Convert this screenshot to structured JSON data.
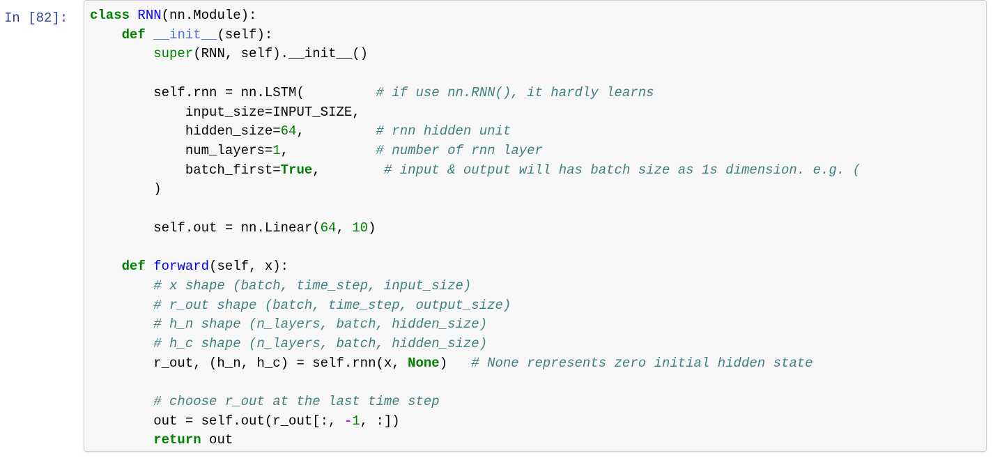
{
  "cell": {
    "prompt": "In [82]:",
    "kernel_language": "python",
    "background_color": "#f7f7f7",
    "border_color": "#cfcfcf",
    "colors": {
      "prompt": "#303f9f",
      "keyword": "#008000",
      "builtin": "#008000",
      "class_name": "#0000ff",
      "function_name": "#0000ff",
      "number": "#008000",
      "operator": "#aa22ff",
      "comment": "#408080",
      "plain": "#000000"
    },
    "lines": [
      {
        "id": "line-1",
        "tokens": [
          {
            "t": "class",
            "c": "keyword"
          },
          {
            "t": " ",
            "c": "plain"
          },
          {
            "t": "RNN",
            "c": "classname"
          },
          {
            "t": "(nn.Module):",
            "c": "plain"
          }
        ]
      },
      {
        "id": "line-2",
        "tokens": [
          {
            "t": "    ",
            "c": "plain"
          },
          {
            "t": "def",
            "c": "keyword"
          },
          {
            "t": " ",
            "c": "plain"
          },
          {
            "t": "__init__",
            "c": "magic"
          },
          {
            "t": "(self):",
            "c": "plain"
          }
        ]
      },
      {
        "id": "line-3",
        "tokens": [
          {
            "t": "        ",
            "c": "plain"
          },
          {
            "t": "super",
            "c": "builtin"
          },
          {
            "t": "(RNN, self).__init__()",
            "c": "plain"
          }
        ]
      },
      {
        "id": "line-4",
        "tokens": [
          {
            "t": "",
            "c": "plain"
          }
        ]
      },
      {
        "id": "line-5",
        "tokens": [
          {
            "t": "        self.rnn = nn.LSTM(         ",
            "c": "plain"
          },
          {
            "t": "# if use nn.RNN(), it hardly learns",
            "c": "comment"
          }
        ]
      },
      {
        "id": "line-6",
        "tokens": [
          {
            "t": "            input_size=INPUT_SIZE,",
            "c": "plain"
          }
        ]
      },
      {
        "id": "line-7",
        "tokens": [
          {
            "t": "            hidden_size=",
            "c": "plain"
          },
          {
            "t": "64",
            "c": "number"
          },
          {
            "t": ",         ",
            "c": "plain"
          },
          {
            "t": "# rnn hidden unit",
            "c": "comment"
          }
        ]
      },
      {
        "id": "line-8",
        "tokens": [
          {
            "t": "            num_layers=",
            "c": "plain"
          },
          {
            "t": "1",
            "c": "number"
          },
          {
            "t": ",           ",
            "c": "plain"
          },
          {
            "t": "# number of rnn layer",
            "c": "comment"
          }
        ]
      },
      {
        "id": "line-9",
        "tokens": [
          {
            "t": "            batch_first=",
            "c": "plain"
          },
          {
            "t": "True",
            "c": "bool"
          },
          {
            "t": ",        ",
            "c": "plain"
          },
          {
            "t": "# input & output will has batch size as 1s dimension. e.g. (",
            "c": "comment"
          }
        ]
      },
      {
        "id": "line-10",
        "tokens": [
          {
            "t": "        )",
            "c": "plain"
          }
        ]
      },
      {
        "id": "line-11",
        "tokens": [
          {
            "t": "",
            "c": "plain"
          }
        ]
      },
      {
        "id": "line-12",
        "tokens": [
          {
            "t": "        self.out = nn.Linear(",
            "c": "plain"
          },
          {
            "t": "64",
            "c": "number"
          },
          {
            "t": ", ",
            "c": "plain"
          },
          {
            "t": "10",
            "c": "number"
          },
          {
            "t": ")",
            "c": "plain"
          }
        ]
      },
      {
        "id": "line-13",
        "tokens": [
          {
            "t": "",
            "c": "plain"
          }
        ]
      },
      {
        "id": "line-14",
        "tokens": [
          {
            "t": "    ",
            "c": "plain"
          },
          {
            "t": "def",
            "c": "keyword"
          },
          {
            "t": " ",
            "c": "plain"
          },
          {
            "t": "forward",
            "c": "funcname"
          },
          {
            "t": "(self, x):",
            "c": "plain"
          }
        ]
      },
      {
        "id": "line-15",
        "tokens": [
          {
            "t": "        ",
            "c": "plain"
          },
          {
            "t": "# x shape (batch, time_step, input_size)",
            "c": "comment"
          }
        ]
      },
      {
        "id": "line-16",
        "tokens": [
          {
            "t": "        ",
            "c": "plain"
          },
          {
            "t": "# r_out shape (batch, time_step, output_size)",
            "c": "comment"
          }
        ]
      },
      {
        "id": "line-17",
        "tokens": [
          {
            "t": "        ",
            "c": "plain"
          },
          {
            "t": "# h_n shape (n_layers, batch, hidden_size)",
            "c": "comment"
          }
        ]
      },
      {
        "id": "line-18",
        "tokens": [
          {
            "t": "        ",
            "c": "plain"
          },
          {
            "t": "# h_c shape (n_layers, batch, hidden_size)",
            "c": "comment"
          }
        ]
      },
      {
        "id": "line-19",
        "tokens": [
          {
            "t": "        r_out, (h_n, h_c) = self.rnn(x, ",
            "c": "plain"
          },
          {
            "t": "None",
            "c": "bool"
          },
          {
            "t": ")   ",
            "c": "plain"
          },
          {
            "t": "# None represents zero initial hidden state",
            "c": "comment"
          }
        ]
      },
      {
        "id": "line-20",
        "tokens": [
          {
            "t": "",
            "c": "plain"
          }
        ]
      },
      {
        "id": "line-21",
        "tokens": [
          {
            "t": "        ",
            "c": "plain"
          },
          {
            "t": "# choose r_out at the last time step",
            "c": "comment"
          }
        ]
      },
      {
        "id": "line-22",
        "tokens": [
          {
            "t": "        out = self.out(r_out[:, ",
            "c": "plain"
          },
          {
            "t": "-",
            "c": "operator"
          },
          {
            "t": "1",
            "c": "number"
          },
          {
            "t": ", :])",
            "c": "plain"
          }
        ]
      },
      {
        "id": "line-23",
        "tokens": [
          {
            "t": "        ",
            "c": "plain"
          },
          {
            "t": "return",
            "c": "keyword"
          },
          {
            "t": " out",
            "c": "plain"
          }
        ]
      }
    ]
  }
}
